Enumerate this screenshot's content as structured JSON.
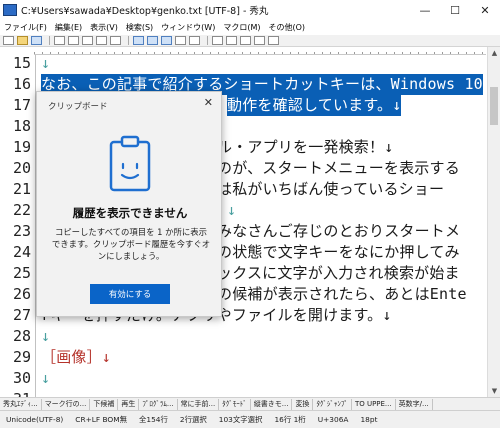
{
  "window": {
    "title": "C:¥Users¥sawada¥Desktop¥genko.txt  [UTF-8] - 秀丸"
  },
  "window_controls": {
    "minimize": "—",
    "maximize": "☐",
    "close": "✕"
  },
  "menu": [
    "ファイル(F)",
    "編集(E)",
    "表示(V)",
    "検索(S)",
    "ウィンドウ(W)",
    "マクロ(M)",
    "その他(O)"
  ],
  "line_numbers": [
    "15",
    "16",
    "17",
    "18",
    "19",
    "20",
    "21",
    "22",
    "23",
    "24",
    "25",
    "26",
    "27",
    "28",
    "29",
    "30",
    "31"
  ],
  "lines": [
    {
      "text": "↓",
      "selected": false
    },
    {
      "text": "なお、この記事で紹介するショートカットキーは、Windows 10",
      "selected": true
    },
    {
      "text": "動作を確認しています。↓",
      "selected": true
    },
    {
      "text": "",
      "selected": false
    },
    {
      "text": "ル・アプリを一発検索！↓",
      "selected": false
    },
    {
      "text": "のが、スタートメニューを表示する",
      "selected": false
    },
    {
      "text": "は私がいちばん使っているショー",
      "selected": false
    },
    {
      "text": "↓",
      "selected": false
    },
    {
      "text": "みなさんご存じのとおりスタートメ",
      "selected": false
    },
    {
      "text": "の状態で文字キーをなにか押してみ",
      "selected": false
    },
    {
      "text": "ックスに文字が入力され検索が始ま",
      "selected": false
    },
    {
      "text": "の候補が表示されたら、あとはEnte",
      "selected": false
    },
    {
      "text": "rキーを押すだけ。アプリやファイルを開けます。↓",
      "selected": false
    },
    {
      "text": "↓",
      "selected": false
    },
    {
      "text": "［画像］↓",
      "selected": false
    },
    {
      "text": "↓",
      "selected": false
    }
  ],
  "clipboard": {
    "title": "クリップボード",
    "close": "✕",
    "heading": "履歴を表示できません",
    "description": "コピーしたすべての項目を 1 か所に表示できます。クリップボード履歴を今すぐオンにしましょう。",
    "button": "有効にする",
    "accent": "#0a64c8"
  },
  "function_keys": [
    "秀丸ｴﾃﾞｨ...",
    "マーク行の...",
    "下候補",
    "再生",
    "ﾌﾟﾛｸﾞﾗﾑ...",
    "常に手前...",
    "ﾀｸﾞﾓｰﾄﾞ",
    "縦書きモ...",
    "変換",
    "ﾀｸﾞｼﾞｬﾝﾌﾟ",
    "TO UPPE...",
    "英数字/..."
  ],
  "status": [
    "Unicode(UTF-8)",
    "CR+LF BOM無",
    "全154行",
    "2行選択",
    "103文字選択",
    "16行 1桁",
    "U+306A",
    "18pt"
  ],
  "colors": {
    "selection": "#0a5fb5",
    "newline_mark": "#4aa0a0",
    "heading": "#b5332b"
  }
}
